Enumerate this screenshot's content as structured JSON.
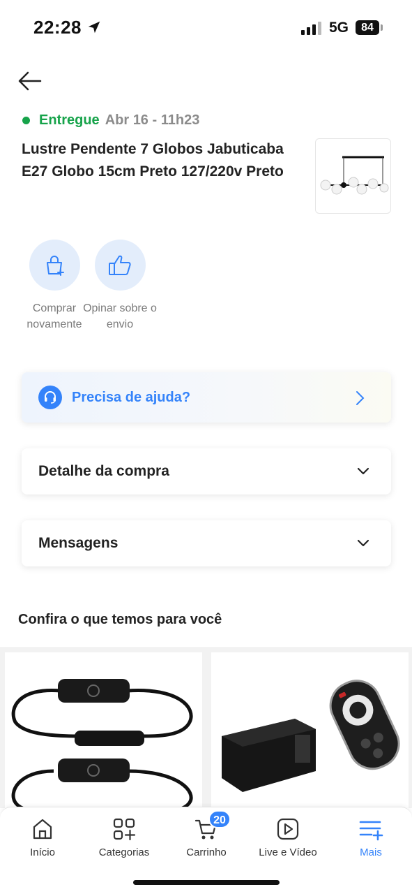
{
  "status_bar": {
    "time": "22:28",
    "network": "5G",
    "battery": "84"
  },
  "order": {
    "status": "Entregue",
    "date": "Abr 16 - 11h23",
    "product_title": "Lustre Pendente 7 Globos Jabuticaba E27 Globo 15cm Preto 127/220v Preto"
  },
  "actions": [
    {
      "label": "Comprar novamente",
      "icon": "bag-plus-icon"
    },
    {
      "label": "Opinar sobre o envio",
      "icon": "thumbs-up-icon"
    }
  ],
  "help": {
    "label": "Precisa de ajuda?"
  },
  "sections": {
    "detail": "Detalhe da compra",
    "messages": "Mensagens"
  },
  "recommendations": {
    "title": "Confira o que temos para você"
  },
  "bottom_nav": {
    "items": [
      {
        "label": "Início",
        "icon": "home-icon"
      },
      {
        "label": "Categorias",
        "icon": "categories-icon"
      },
      {
        "label": "Carrinho",
        "icon": "cart-icon",
        "badge": "20"
      },
      {
        "label": "Live e Vídeo",
        "icon": "play-icon"
      },
      {
        "label": "Mais",
        "icon": "menu-plus-icon",
        "active": true
      }
    ]
  },
  "colors": {
    "accent": "#3483fa",
    "success": "#16a34a",
    "muted": "#8b8b8b"
  }
}
